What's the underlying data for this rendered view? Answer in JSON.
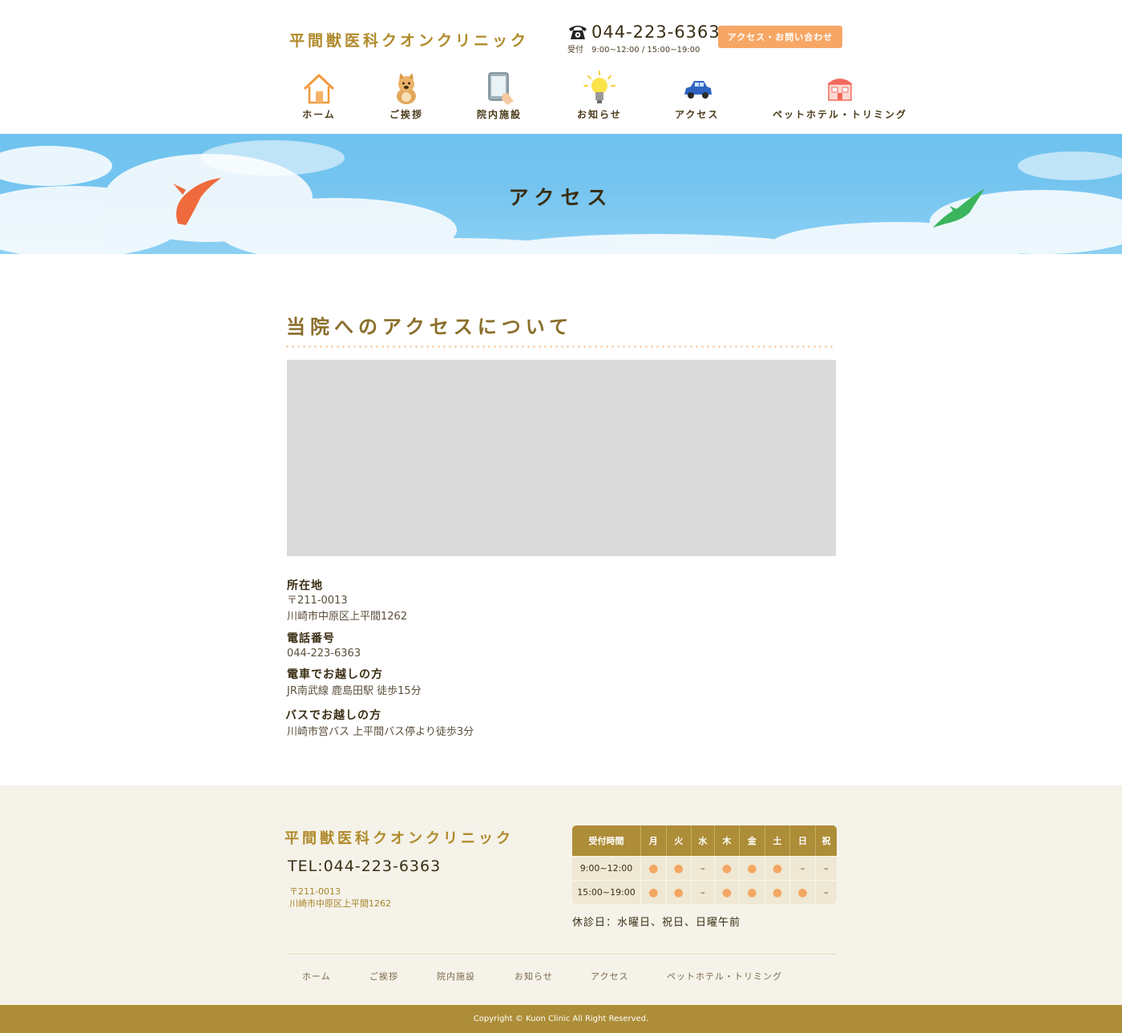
{
  "header": {
    "logo": "平間獣医科クオンクリニック",
    "tel": "044-223-6363",
    "hours_label": "受付",
    "hours": "9:00~12:00 / 15:00~19:00",
    "contact_button": "アクセス・お問い合わせ"
  },
  "nav": [
    {
      "label": "ホーム",
      "icon": "house-icon"
    },
    {
      "label": "ご挨拶",
      "icon": "cat-icon"
    },
    {
      "label": "院内施設",
      "icon": "tablet-icon"
    },
    {
      "label": "お知らせ",
      "icon": "lightbulb-icon"
    },
    {
      "label": "アクセス",
      "icon": "car-icon"
    },
    {
      "label": "ペットホテル・トリミング",
      "icon": "hotel-icon"
    }
  ],
  "hero": {
    "title": "アクセス"
  },
  "main": {
    "section_title": "当院へのアクセスについて",
    "info": [
      {
        "heading": "所在地",
        "lines": [
          "〒211-0013",
          "川崎市中原区上平間1262"
        ]
      },
      {
        "heading": "電話番号",
        "lines": [
          "044-223-6363"
        ]
      },
      {
        "heading": "電車でお越しの方",
        "lines": [
          "JR南武線 鹿島田駅 徒歩15分"
        ]
      },
      {
        "heading": "バスでお越しの方",
        "lines": [
          "川崎市営バス 上平間バス停より徒歩3分"
        ]
      }
    ]
  },
  "footer": {
    "logo": "平間獣医科クオンクリニック",
    "tel": "TEL:044-223-6363",
    "postal": "〒211-0013",
    "address": "川崎市中原区上平間1262",
    "hours_table": {
      "header": [
        "受付時間",
        "月",
        "火",
        "水",
        "木",
        "金",
        "土",
        "日",
        "祝"
      ],
      "rows": [
        [
          "9:00~12:00",
          "●",
          "●",
          "–",
          "●",
          "●",
          "●",
          "–",
          "–"
        ],
        [
          "15:00~19:00",
          "●",
          "●",
          "–",
          "●",
          "●",
          "●",
          "●",
          "–"
        ]
      ]
    },
    "closed_note": "休診日：水曜日、祝日、日曜午前",
    "nav": [
      "ホーム",
      "ご挨拶",
      "院内施設",
      "お知らせ",
      "アクセス",
      "ペットホテル・トリミング"
    ],
    "copyright": "Copyright © Kuon Clinic All Right Reserved."
  },
  "colors": {
    "accent_gold": "#ad8d37",
    "orange": "#f7a765",
    "sky": "#74c4f0"
  }
}
